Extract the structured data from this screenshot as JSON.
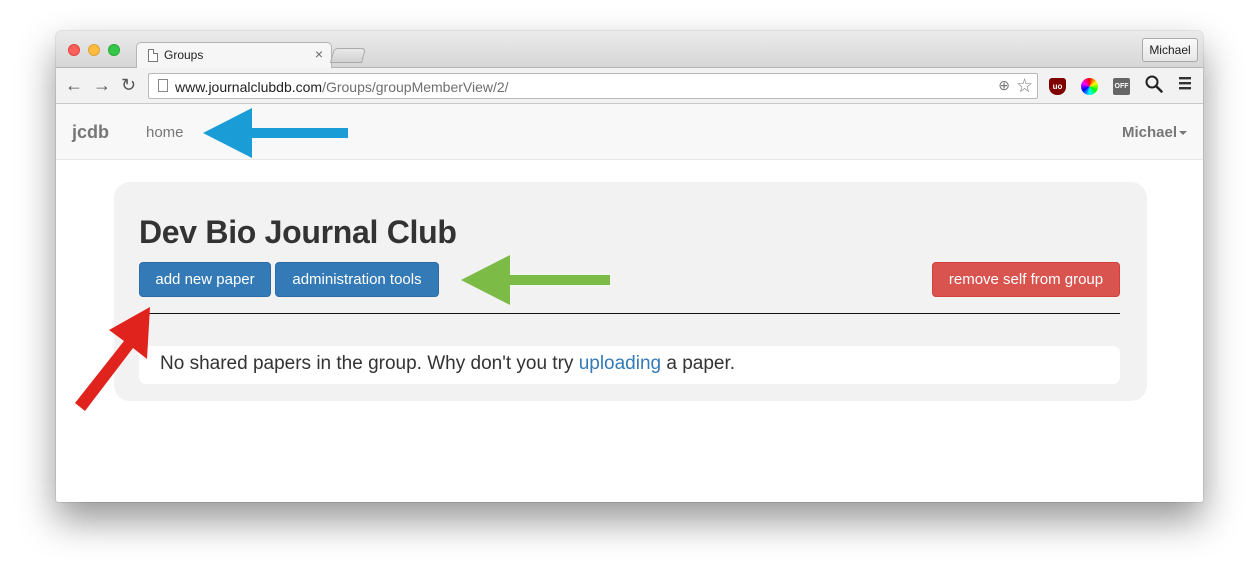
{
  "browser": {
    "tab_title": "Groups",
    "tab_close": "×",
    "profile_name": "Michael",
    "url_host": "www.journalclubdb.com",
    "url_path": "/Groups/groupMemberView/2/",
    "nav": {
      "back": "←",
      "forward": "→",
      "reload": "↻"
    },
    "extensions": {
      "ublock": "uo",
      "off": "OFF"
    }
  },
  "navbar": {
    "brand": "jcdb",
    "home_link": "home",
    "user_menu": "Michael"
  },
  "group": {
    "title": "Dev Bio Journal Club",
    "add_paper_label": "add new paper",
    "admin_tools_label": "administration tools",
    "remove_self_label": "remove self from group",
    "empty_message_before": "No shared papers in the group. Why don't you try ",
    "empty_message_link": "uploading",
    "empty_message_after": " a paper."
  },
  "annotations": {
    "colors": {
      "blue_arrow": "#1a9cd6",
      "green_arrow": "#7cbb45",
      "red_arrow": "#e0231d"
    }
  },
  "colors": {
    "primary": "#337ab7",
    "danger": "#d9534f",
    "jumbotron_bg": "#f2f2f2",
    "navbar_bg": "#f8f8f8"
  }
}
